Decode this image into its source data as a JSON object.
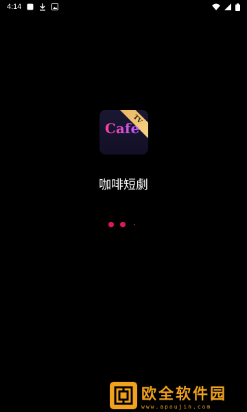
{
  "status_bar": {
    "time": "4:14",
    "icons": [
      "square-notification-icon",
      "download-icon",
      "image-notification-icon",
      "wifi-icon",
      "signal-icon",
      "battery-icon"
    ]
  },
  "splash": {
    "app_name": "咖啡短劇",
    "icon": {
      "logo_text": "Cafe",
      "ribbon_text": "TV",
      "accent": "#ff3fa4"
    },
    "loader": {
      "dot_color": "#e0165f"
    }
  },
  "watermark": {
    "title": "欧全软件园",
    "url": "www.apoujin.com",
    "color": "#f0a11e"
  }
}
